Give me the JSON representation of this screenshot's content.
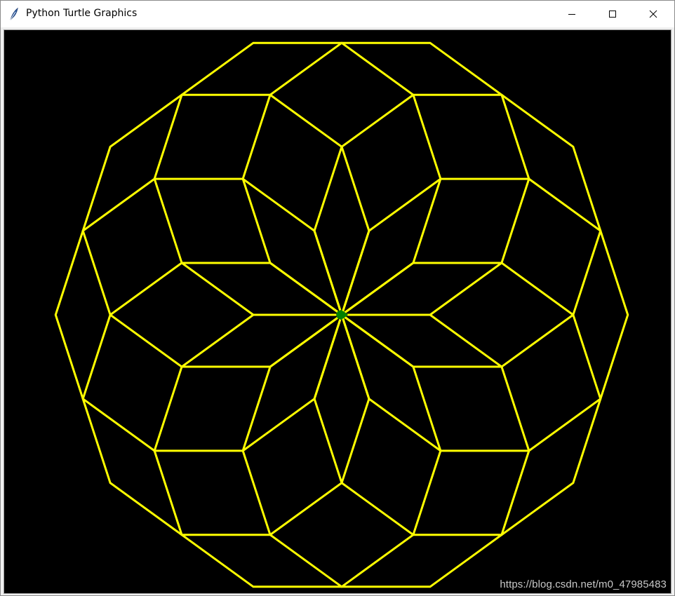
{
  "window": {
    "title": "Python Turtle Graphics",
    "controls": {
      "minimize_icon": "minimize-icon",
      "maximize_icon": "maximize-icon",
      "close_icon": "close-icon"
    },
    "app_icon": "feather-icon"
  },
  "canvas": {
    "background_color": "#000000",
    "pen_color": "#ffff00",
    "turtle_color": "#008000",
    "pen_width": 3,
    "pattern": {
      "shape": "decagon",
      "repetitions": 10,
      "sides_per_shape": 10
    }
  },
  "watermark": {
    "text": "https://blog.csdn.net/m0_47985483"
  }
}
